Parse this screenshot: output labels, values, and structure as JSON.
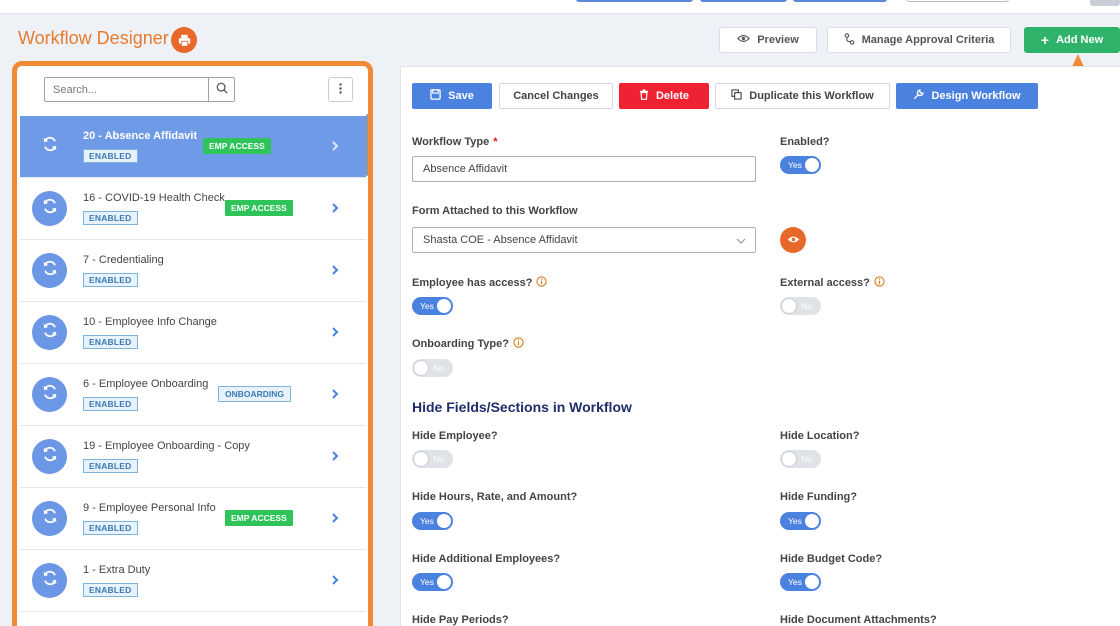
{
  "header": {
    "title": "Workflow Designer",
    "preview_label": "Preview",
    "criteria_label": "Manage Approval Criteria",
    "add_new_label": "Add New"
  },
  "list": {
    "search_placeholder": "Search...",
    "items": [
      {
        "name": "20 - Absence Affidavit",
        "status": "ENABLED",
        "badge": "EMP ACCESS",
        "active": true
      },
      {
        "name": "16 - COVID-19 Health Check",
        "status": "ENABLED",
        "badge": "EMP ACCESS"
      },
      {
        "name": "7 - Credentialing",
        "status": "ENABLED"
      },
      {
        "name": "10 - Employee Info Change",
        "status": "ENABLED"
      },
      {
        "name": "6 - Employee Onboarding",
        "status": "ENABLED",
        "badge": "ONBOARDING"
      },
      {
        "name": "19 - Employee Onboarding - Copy",
        "status": "ENABLED"
      },
      {
        "name": "9 - Employee Personal Info",
        "status": "ENABLED",
        "badge": "EMP ACCESS"
      },
      {
        "name": "1 - Extra Duty",
        "status": "ENABLED"
      }
    ]
  },
  "actions": {
    "save": "Save",
    "cancel": "Cancel Changes",
    "delete": "Delete",
    "duplicate": "Duplicate this Workflow",
    "design": "Design Workflow"
  },
  "form": {
    "workflow_type_label": "Workflow Type",
    "required_mark": "*",
    "workflow_type_value": "Absence Affidavit",
    "enabled_label": "Enabled?",
    "enabled_toggle": "Yes",
    "form_attached_label": "Form Attached to this Workflow",
    "form_attached_value": "Shasta COE - Absence Affidavit",
    "emp_access_label": "Employee has access?",
    "emp_access_toggle": "Yes",
    "ext_access_label": "External access?",
    "ext_access_toggle": "No",
    "onboarding_label": "Onboarding Type?",
    "onboarding_toggle": "No"
  },
  "hide_section": {
    "title": "Hide Fields/Sections in Workflow",
    "hide_employee_label": "Hide Employee?",
    "hide_employee_toggle": "No",
    "hide_location_label": "Hide Location?",
    "hide_location_toggle": "No",
    "hide_hours_label": "Hide Hours, Rate, and Amount?",
    "hide_hours_toggle": "Yes",
    "hide_funding_label": "Hide Funding?",
    "hide_funding_toggle": "Yes",
    "hide_additional_label": "Hide Additional Employees?",
    "hide_additional_toggle": "Yes",
    "hide_budget_label": "Hide Budget Code?",
    "hide_budget_toggle": "Yes",
    "hide_pay_label": "Hide Pay Periods?",
    "hide_docs_label": "Hide Document Attachments?"
  },
  "colors": {
    "accent_orange": "#ef8a36",
    "primary_blue": "#4c82df",
    "success_green": "#2fb36b",
    "danger_red": "#ee2233",
    "section_navy": "#1f2d6b"
  }
}
